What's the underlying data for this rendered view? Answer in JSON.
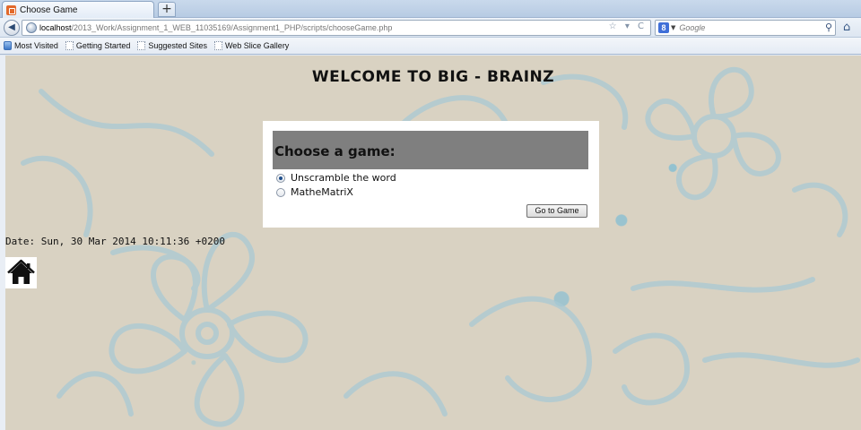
{
  "browser": {
    "tab_title": "Choose Game",
    "new_tab_label": "+",
    "url_host": "localhost",
    "url_path": "/2013_Work/Assignment_1_WEB_11035169/Assignment1_PHP/scripts/chooseGame.php",
    "url_actions": "☆ ▾ C",
    "search_engine_label": "8",
    "search_placeholder": "Google",
    "bookmarks": [
      {
        "label": "Most Visited"
      },
      {
        "label": "Getting Started"
      },
      {
        "label": "Suggested Sites"
      },
      {
        "label": "Web Slice Gallery"
      }
    ]
  },
  "page": {
    "title": "WELCOME TO BIG - BRAINZ",
    "form": {
      "heading": "Choose a game:",
      "options": [
        {
          "label": "Unscramble the word",
          "checked": true
        },
        {
          "label": "MatheMatriX",
          "checked": false
        }
      ],
      "submit_label": "Go to Game"
    },
    "date_text": "Date: Sun, 30 Mar 2014 10:11:36 +0200"
  },
  "colors": {
    "page_background": "#d9d2c2",
    "pattern_stroke": "#9fc7d6",
    "card_header": "#7f7f7f"
  },
  "icons": {
    "home_link": "home-icon"
  }
}
